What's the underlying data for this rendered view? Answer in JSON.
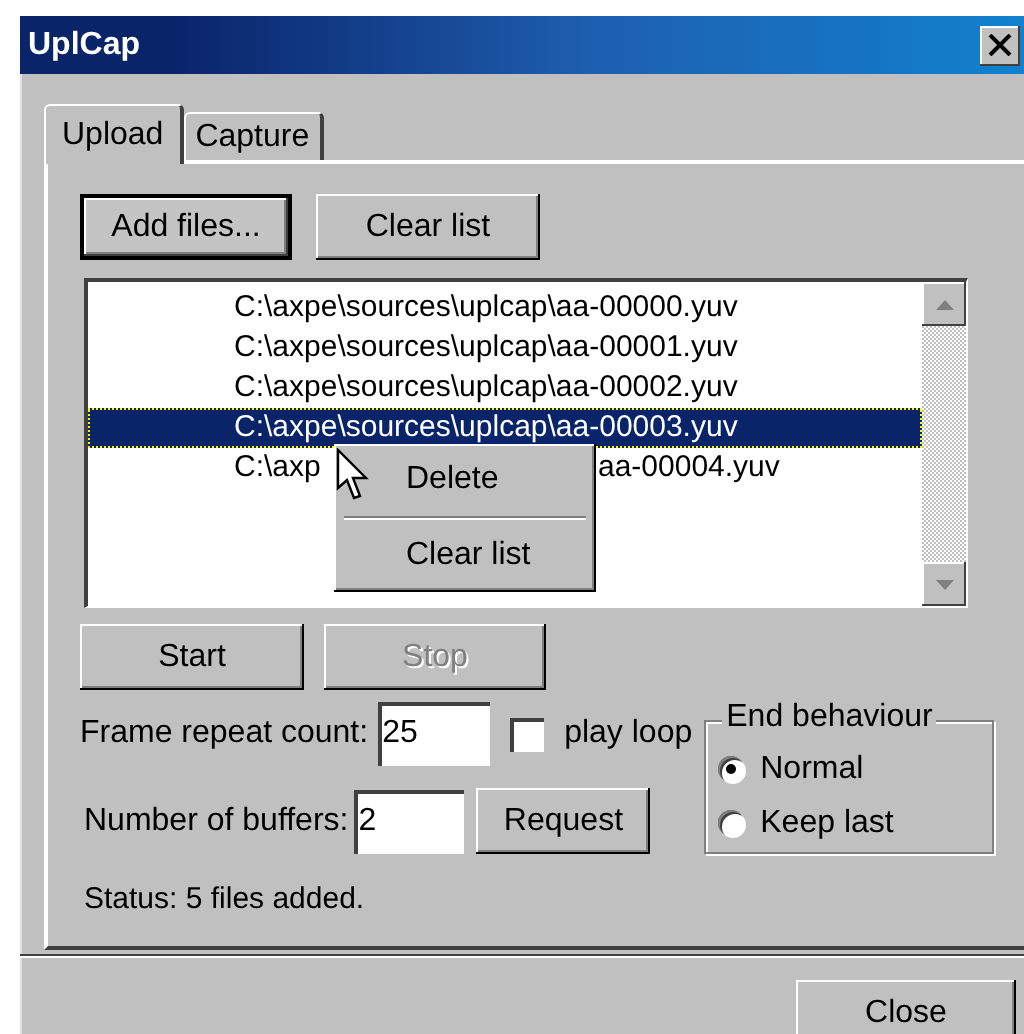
{
  "window": {
    "title": "UplCap"
  },
  "tabs": [
    {
      "label": "Upload",
      "selected": true
    },
    {
      "label": "Capture",
      "selected": false
    }
  ],
  "list_buttons": [
    {
      "label": "Add files...",
      "focused": true
    },
    {
      "label": "Clear list",
      "focused": false
    }
  ],
  "file_list": {
    "items": [
      {
        "text_parts": [
          "C:\\axpe\\sources\\uplcap\\aa-00000.yuv"
        ],
        "selected": false
      },
      {
        "text_parts": [
          "C:\\axpe\\sources\\uplcap\\aa-00001.yuv"
        ],
        "selected": false
      },
      {
        "text_parts": [
          "C:\\axpe\\sources\\uplcap\\aa-00002.yuv"
        ],
        "selected": false
      },
      {
        "text_parts": [
          "C:\\axpe\\sources\\uplcap\\aa-00003.yuv"
        ],
        "selected": true
      },
      {
        "text_parts": [
          "C:\\axp",
          "aa-00004.yuv"
        ],
        "selected": false
      }
    ]
  },
  "context_menu": {
    "items": [
      {
        "kind": "item",
        "label": "Delete"
      },
      {
        "kind": "separator"
      },
      {
        "kind": "item",
        "label": "Clear list"
      }
    ]
  },
  "playback_buttons": [
    {
      "label": "Start",
      "disabled": false
    },
    {
      "label": "Stop",
      "disabled": true
    }
  ],
  "frame_repeat": {
    "label": "Frame repeat count:",
    "value": "25"
  },
  "play_loop": {
    "label": "play loop",
    "checked": false
  },
  "end_behaviour": {
    "title": "End behaviour",
    "options": [
      {
        "label": "Normal",
        "selected": true
      },
      {
        "label": "Keep last",
        "selected": false
      }
    ]
  },
  "buffers": {
    "label": "Number of buffers:",
    "value": "2",
    "button": "Request"
  },
  "status": "Status: 5 files added.",
  "close_button": "Close"
}
